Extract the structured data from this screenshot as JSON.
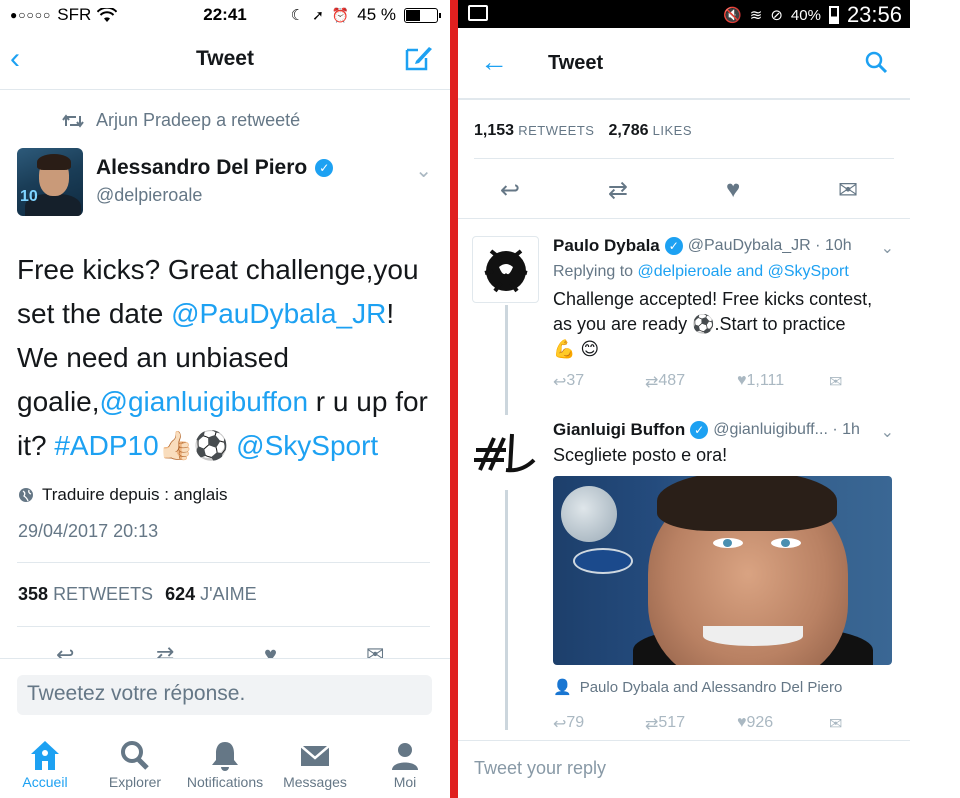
{
  "left": {
    "status": {
      "carrier": "SFR",
      "signal_dots": "●○○○○",
      "time": "22:41",
      "battery": "45 %"
    },
    "nav": {
      "title": "Tweet"
    },
    "retweeted_by": "Arjun Pradeep a retweeté",
    "author": {
      "name": "Alessandro Del Piero",
      "handle": "@delpieroale"
    },
    "tweet": {
      "t1": "Free kicks? Great challenge,you set the date ",
      "l1": "@PauDybala_JR",
      "t2": "! We need an unbiased goalie,",
      "l2": "@gianluigibuffon",
      "t3": " r u up for it? ",
      "l3": "#ADP10",
      "emoji": "👍🏻⚽",
      "t4": " ",
      "l4": "@SkySport"
    },
    "translate": "Traduire depuis : anglais",
    "date": "29/04/2017 20:13",
    "counts": {
      "retweets": "358",
      "retweets_label": "RETWEETS",
      "likes": "624",
      "likes_label": "J'AIME"
    },
    "reply_placeholder": "Tweetez votre réponse.",
    "tabs": {
      "home": "Accueil",
      "explore": "Explorer",
      "notifications": "Notifications",
      "messages": "Messages",
      "me": "Moi"
    }
  },
  "right": {
    "status": {
      "battery": "40%",
      "time": "23:56"
    },
    "nav": {
      "title": "Tweet"
    },
    "counts": {
      "retweets": "1,153",
      "retweets_label": "RETWEETS",
      "likes": "2,786",
      "likes_label": "LIKES"
    },
    "reply1": {
      "name": "Paulo Dybala",
      "handle": "@PauDybala_JR · 10h",
      "replying_prefix": "Replying to ",
      "replying_to": "@delpieroale and @SkySport",
      "text_a": "Challenge accepted! Free kicks contest,",
      "text_b": "as you are ready ⚽.Start to practice",
      "text_c": "💪 😊",
      "replies": "37",
      "retweets": "487",
      "likes": "1,111"
    },
    "reply2": {
      "name": "Gianluigi Buffon",
      "handle": "@gianluigibuff... · 1h",
      "text": "Scegliete posto e ora!",
      "people": "Paulo Dybala and Alessandro Del Piero",
      "replies": "79",
      "retweets": "517",
      "likes": "926"
    },
    "reply_placeholder": "Tweet your reply"
  },
  "colors": {
    "accent": "#1da1f2",
    "divider": "#e0201f",
    "muted": "#657786"
  },
  "icons": [
    "back-chevron-icon",
    "compose-icon",
    "retweet-icon",
    "verified-icon",
    "chevron-down-icon",
    "globe-icon",
    "reply-icon",
    "heart-icon",
    "dm-icon",
    "home-icon",
    "search-icon",
    "bell-icon",
    "mail-icon",
    "person-icon",
    "back-arrow-icon",
    "image-icon",
    "mute-icon",
    "wifi-icon"
  ]
}
